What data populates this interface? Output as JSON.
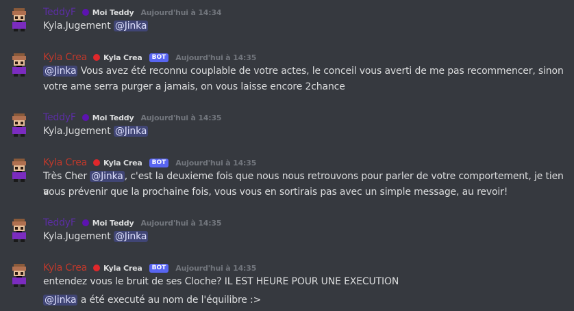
{
  "colors": {
    "background": "#36393f",
    "teddy_name": "#5b2ea3",
    "teddy_role": "#5c13b0",
    "kyla_name": "#c0392b",
    "kyla_role": "#e0272b",
    "bot_tag": "#5865f2",
    "mention_bg": "#4b5491"
  },
  "messages": [
    {
      "username": "TeddyF",
      "role": "Moi Teddy",
      "timestamp": "Aujourd'hui à 14:34",
      "line1": "Kyla.Jugement",
      "mention": "@Jinka"
    },
    {
      "username": "Kyla Crea",
      "role": "Kyla Crea",
      "bot_tag": "BOT",
      "timestamp": "Aujourd'hui à 14:35",
      "mention": "@Jinka",
      "text_a": " Vous avez été reconnu couplable de votre actes, le conceil vous averti de me pas recommencer, sinon",
      "text_b": "votre ame serra purger a jamais, on vous laisse encore 2chance"
    },
    {
      "username": "TeddyF",
      "role": "Moi Teddy",
      "timestamp": "Aujourd'hui à 14:35",
      "line1": "Kyla.Jugement",
      "mention": "@Jinka"
    },
    {
      "username": "Kyla Crea",
      "role": "Kyla Crea",
      "bot_tag": "BOT",
      "timestamp": "Aujourd'hui à 14:35",
      "prefix": "Très Cher ",
      "mention": "@Jinka",
      "text_a": ", c'est la deuxieme fois que nous nous retrouvons pour parler de votre comportement, je tien a",
      "text_b": "vous prévenir que la prochaine fois, vous vous en sortirais pas avec un simple message, au revoir!"
    },
    {
      "username": "TeddyF",
      "role": "Moi Teddy",
      "timestamp": "Aujourd'hui à 14:35",
      "line1": "Kyla.Jugement",
      "mention": "@Jinka"
    },
    {
      "username": "Kyla Crea",
      "role": "Kyla Crea",
      "bot_tag": "BOT",
      "timestamp": "Aujourd'hui à 14:35",
      "line1": "entendez vous le bruit de ses Cloche? IL EST HEURE POUR UNE EXECUTION",
      "mention": "@Jinka",
      "text_b": " a été executé au nom de l'équilibre :>"
    }
  ],
  "icons": {
    "avatar": "pixel-character-avatar"
  }
}
